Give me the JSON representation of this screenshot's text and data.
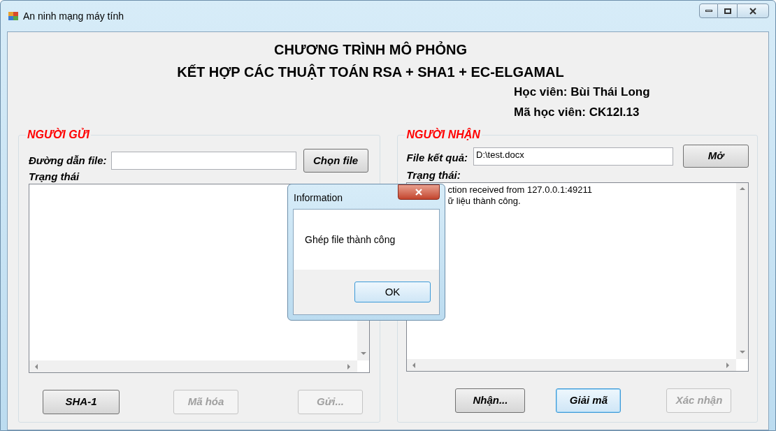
{
  "window": {
    "title": "An ninh mạng máy tính"
  },
  "header": {
    "title_lines": [
      "CHƯƠNG TRÌNH MÔ PHỎNG",
      "KẾT HỢP CÁC THUẬT TOÁN RSA + SHA1 + EC-ELGAMAL"
    ],
    "student_lines": [
      "Học viên: Bùi Thái Long",
      "Mã học viên: CK12I.13"
    ]
  },
  "sender": {
    "legend": "NGƯỜI GỬI",
    "path_label": "Đường dẫn file:",
    "choose_button": "Chọn file",
    "status_label": "Trạng thái",
    "buttons": [
      {
        "label": "SHA-1",
        "disabled": false,
        "focused": false
      },
      {
        "label": "Mã hóa",
        "disabled": true,
        "focused": false
      },
      {
        "label": "Gửi...",
        "disabled": true,
        "focused": false
      }
    ]
  },
  "receiver": {
    "legend": "NGƯỜI NHẬN",
    "result_label": "File kết quả:",
    "result_value": "D:\\test.docx",
    "open_button": "Mở",
    "status_label": "Trạng thái:",
    "log_lines": [
      "ction received from 127.0.0.1:49211",
      "ữ liệu thành công."
    ],
    "buttons": [
      {
        "label": "Nhận...",
        "disabled": false,
        "focused": false
      },
      {
        "label": "Giải mã",
        "disabled": false,
        "focused": true
      },
      {
        "label": "Xác nhận",
        "disabled": true,
        "focused": false
      }
    ]
  },
  "dialog": {
    "title": "Information",
    "message": "Ghép file thành công",
    "ok_button": "OK"
  }
}
